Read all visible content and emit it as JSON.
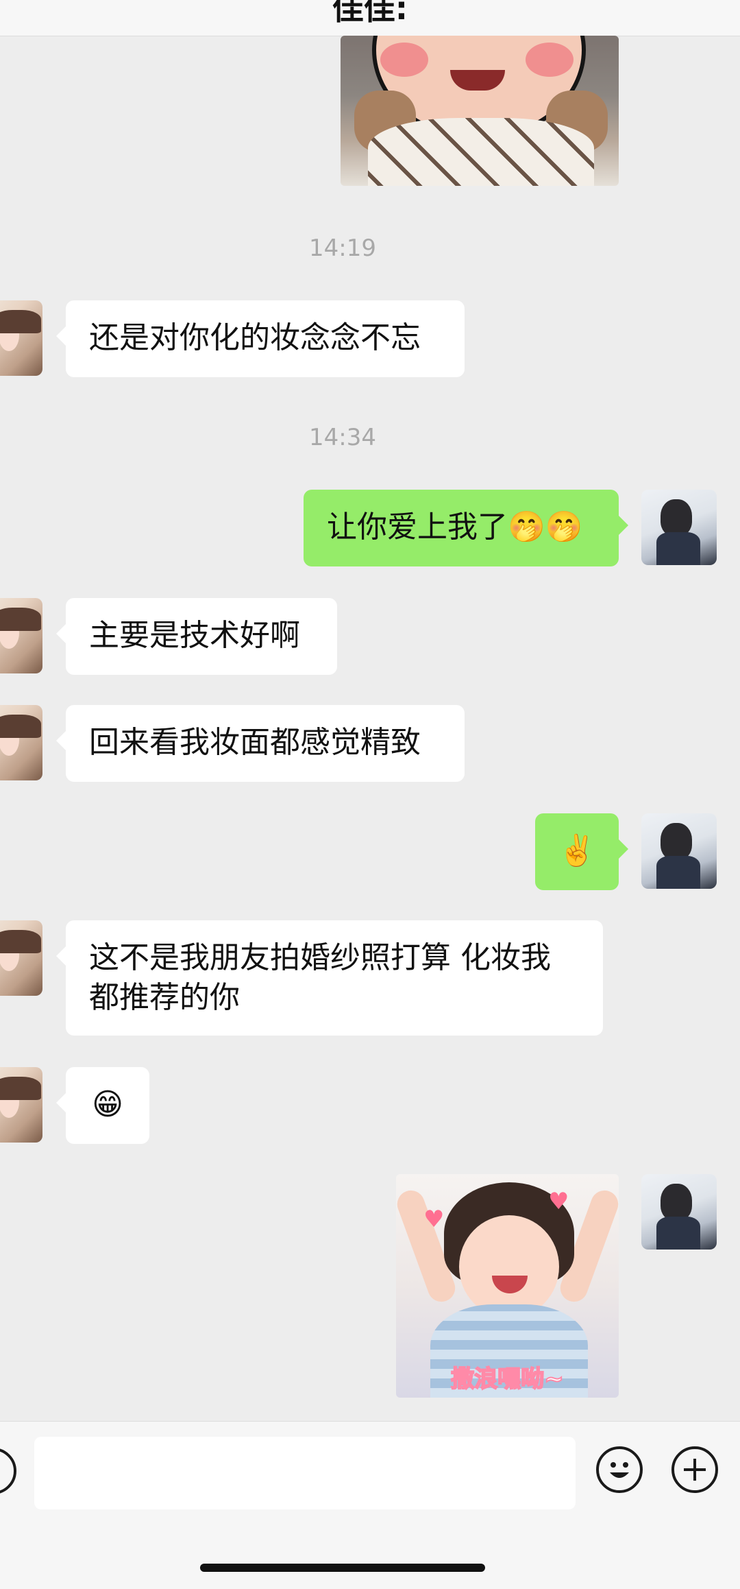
{
  "header": {
    "title": "佳佳:"
  },
  "messages": {
    "ts1": "14:19",
    "m1": "还是对你化的妆念念不忘",
    "ts2": "14:34",
    "m2": "让你爱上我了🤭🤭",
    "m3": "主要是技术好啊",
    "m4": "回来看我妆面都感觉精致",
    "m5": "✌️",
    "m6": "这不是我朋友拍婚纱照打算 化妆我都推荐的你",
    "m7": "😁",
    "sticker_caption": "撒浪嘿呦~"
  },
  "input": {
    "placeholder": ""
  },
  "colors": {
    "chat_background": "#ededed",
    "incoming_bubble": "#ffffff",
    "outgoing_bubble": "#95ec69",
    "timestamp": "#a8a8a8"
  },
  "icons": {
    "voice": "voice-icon",
    "emoji": "emoji-icon",
    "more": "plus-icon"
  }
}
